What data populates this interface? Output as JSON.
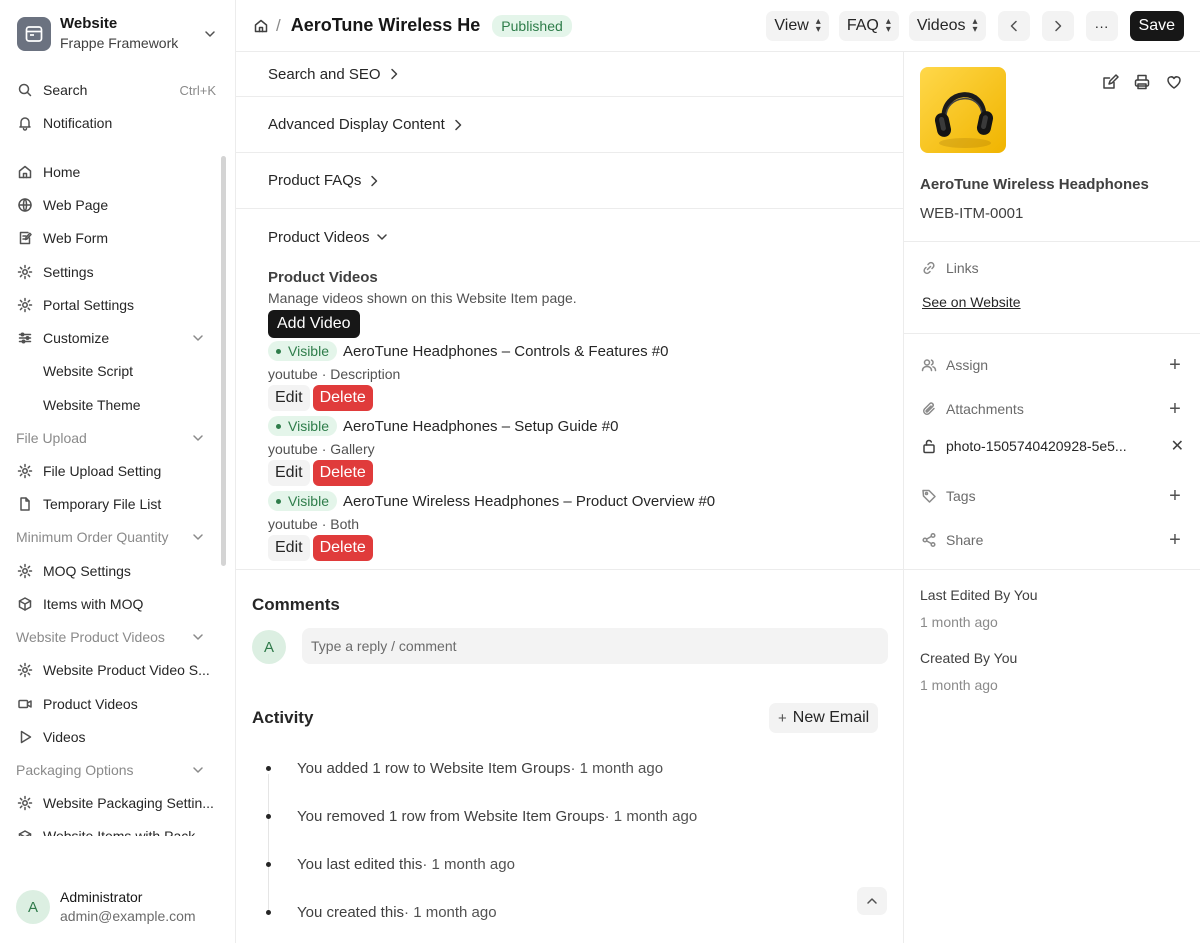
{
  "sidebar": {
    "brand_title": "Website",
    "brand_sub": "Frappe Framework",
    "search_label": "Search",
    "search_shortcut": "Ctrl+K",
    "notification_label": "Notification",
    "items": [
      {
        "label": "Home"
      },
      {
        "label": "Web Page"
      },
      {
        "label": "Web Form"
      },
      {
        "label": "Settings"
      },
      {
        "label": "Portal Settings"
      },
      {
        "label": "Customize"
      },
      {
        "label": "Website Script"
      },
      {
        "label": "Website Theme"
      },
      {
        "label": "File Upload"
      },
      {
        "label": "File Upload Setting"
      },
      {
        "label": "Temporary File List"
      },
      {
        "label": "Minimum Order Quantity"
      },
      {
        "label": "MOQ Settings"
      },
      {
        "label": "Items with MOQ"
      },
      {
        "label": "Website Product Videos"
      },
      {
        "label": "Website Product Video S..."
      },
      {
        "label": "Product Videos"
      },
      {
        "label": "Videos"
      },
      {
        "label": "Packaging Options"
      },
      {
        "label": "Website Packaging Settin..."
      },
      {
        "label": "Website Items with Pack..."
      }
    ],
    "user_initial": "A",
    "user_name": "Administrator",
    "user_email": "admin@example.com"
  },
  "header": {
    "separator": "/",
    "title": "AeroTune Wireless He",
    "status": "Published",
    "view_label": "View",
    "faq_label": "FAQ",
    "videos_label": "Videos",
    "more_label": "···",
    "save_label": "Save"
  },
  "sections": {
    "search_seo": "Search and SEO",
    "advanced_display": "Advanced Display Content",
    "product_faqs": "Product FAQs",
    "product_videos": "Product Videos"
  },
  "videos": {
    "title": "Product Videos",
    "description": "Manage videos shown on this Website Item page.",
    "add_label": "Add Video",
    "edit_label": "Edit",
    "delete_label": "Delete",
    "items": [
      {
        "status": "Visible",
        "name": "AeroTune Headphones – Controls & Features #0",
        "meta": "youtube · Description"
      },
      {
        "status": "Visible",
        "name": "AeroTune Headphones – Setup Guide #0",
        "meta": "youtube · Gallery"
      },
      {
        "status": "Visible",
        "name": "AeroTune Wireless Headphones – Product Overview #0",
        "meta": "youtube · Both"
      }
    ]
  },
  "comments": {
    "title": "Comments",
    "avatar_initial": "A",
    "placeholder": "Type a reply / comment"
  },
  "activity": {
    "title": "Activity",
    "new_email_label": "New Email",
    "items": [
      {
        "text": "You added 1 row to Website Item Groups",
        "when": " · 1 month ago"
      },
      {
        "text": "You removed 1 row from Website Item Groups",
        "when": " · 1 month ago"
      },
      {
        "text": "You last edited this",
        "when": " · 1 month ago"
      },
      {
        "text": "You created this",
        "when": " · 1 month ago"
      }
    ]
  },
  "panel": {
    "product_name": "AeroTune Wireless Headphones",
    "product_code": "WEB-ITM-0001",
    "links_label": "Links",
    "see_website": "See on Website",
    "assign_label": "Assign",
    "attachments_label": "Attachments",
    "attachment_file": "photo-1505740420928-5e5...",
    "tags_label": "Tags",
    "share_label": "Share",
    "last_edited_label": "Last Edited By You",
    "last_edited_when": "1 month ago",
    "created_label": "Created By You",
    "created_when": "1 month ago"
  },
  "colors": {
    "accent": "#171717",
    "success": "#2e7d4a",
    "success_bg": "#e4f5ea",
    "danger": "#e03b3b"
  }
}
